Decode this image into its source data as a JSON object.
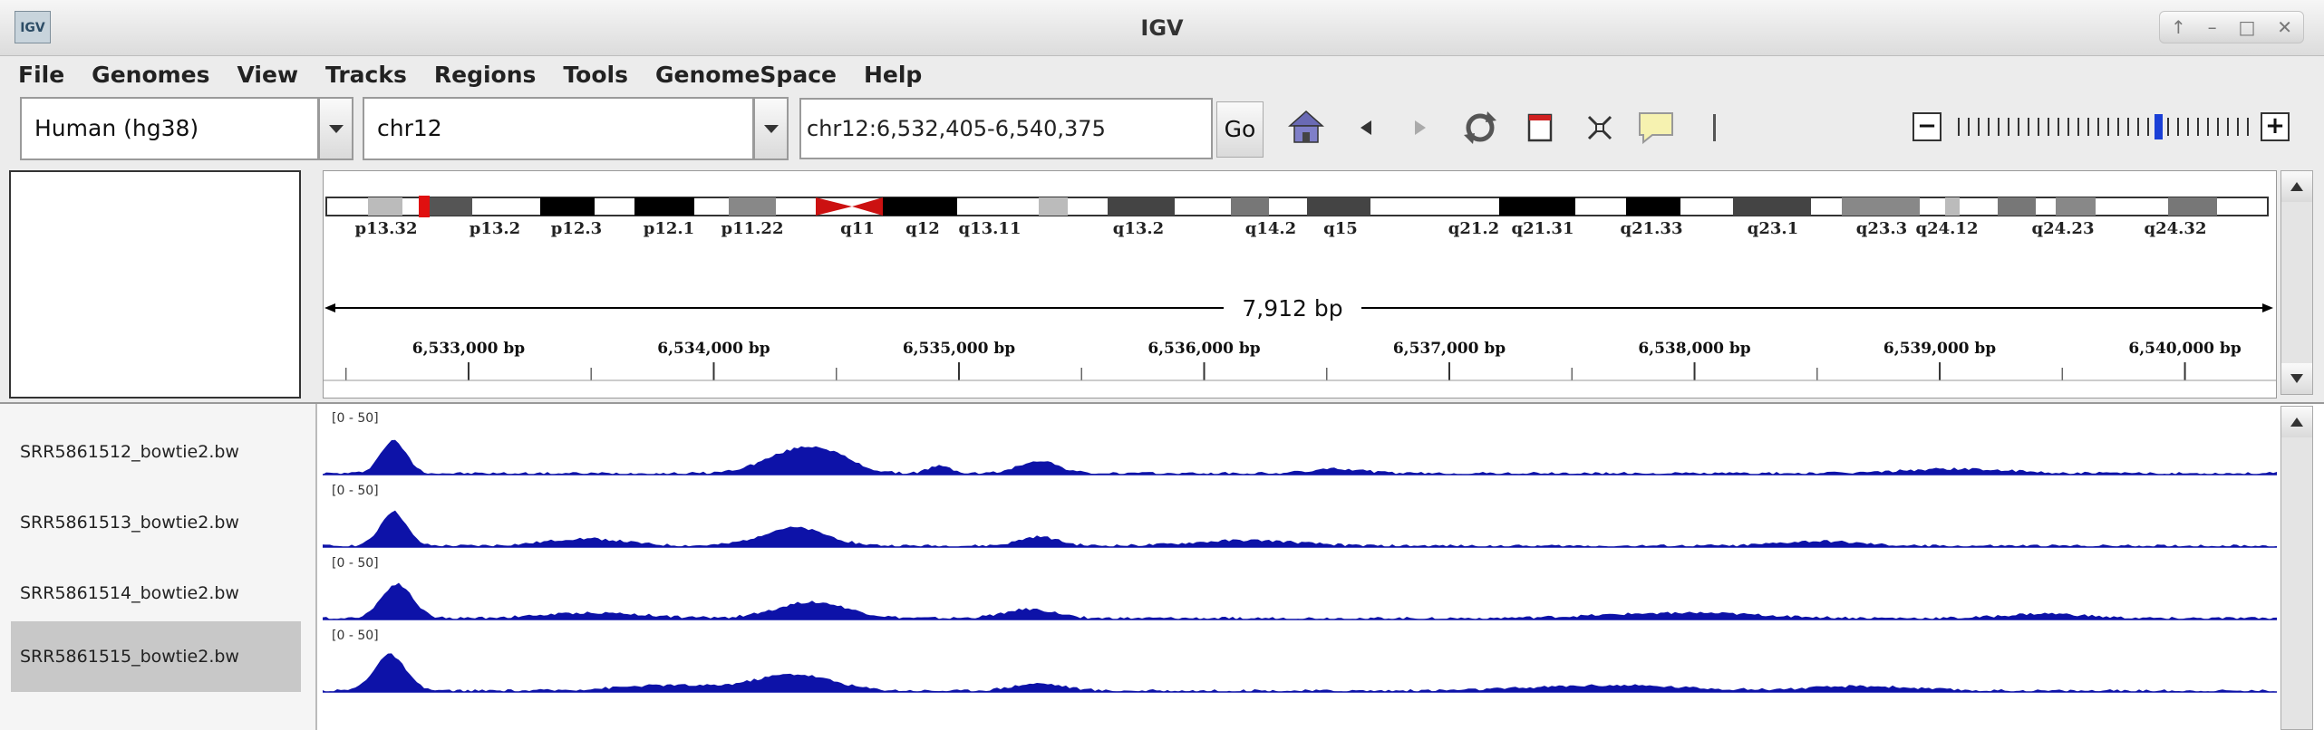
{
  "window": {
    "title": "IGV",
    "app_icon_label": "IGV"
  },
  "menu": [
    "File",
    "Genomes",
    "View",
    "Tracks",
    "Regions",
    "Tools",
    "GenomeSpace",
    "Help"
  ],
  "toolbar": {
    "genome": "Human (hg38)",
    "chromosome": "chr12",
    "locus": "chr12:6,532,405-6,540,375",
    "go_label": "Go"
  },
  "ideogram": {
    "bands": [
      "p13.32",
      "p13.2",
      "p12.3",
      "p12.1",
      "p11.22",
      "q11",
      "q12",
      "q13.11",
      "q13.2",
      "q14.2",
      "q15",
      "q21.2",
      "q21.31",
      "q21.33",
      "q23.1",
      "q23.3",
      "q24.12",
      "q24.23",
      "q24.32"
    ]
  },
  "ruler": {
    "span_label": "7,912 bp",
    "ticks": [
      "6,533,000 bp",
      "6,534,000 bp",
      "6,535,000 bp",
      "6,536,000 bp",
      "6,537,000 bp",
      "6,538,000 bp",
      "6,539,000 bp",
      "6,540,000 bp"
    ]
  },
  "tracks": [
    {
      "name": "SRR5861512_bowtie2.bw",
      "range": "[0 - 50]",
      "selected": false
    },
    {
      "name": "SRR5861513_bowtie2.bw",
      "range": "[0 - 50]",
      "selected": false
    },
    {
      "name": "SRR5861514_bowtie2.bw",
      "range": "[0 - 50]",
      "selected": false
    },
    {
      "name": "SRR5861515_bowtie2.bw",
      "range": "[0 - 50]",
      "selected": true
    }
  ],
  "colors": {
    "signal": "#0d12a8",
    "centromere": "#cc1111",
    "locus_marker": "#e01010",
    "zoom_marker": "#1a3fd6"
  }
}
